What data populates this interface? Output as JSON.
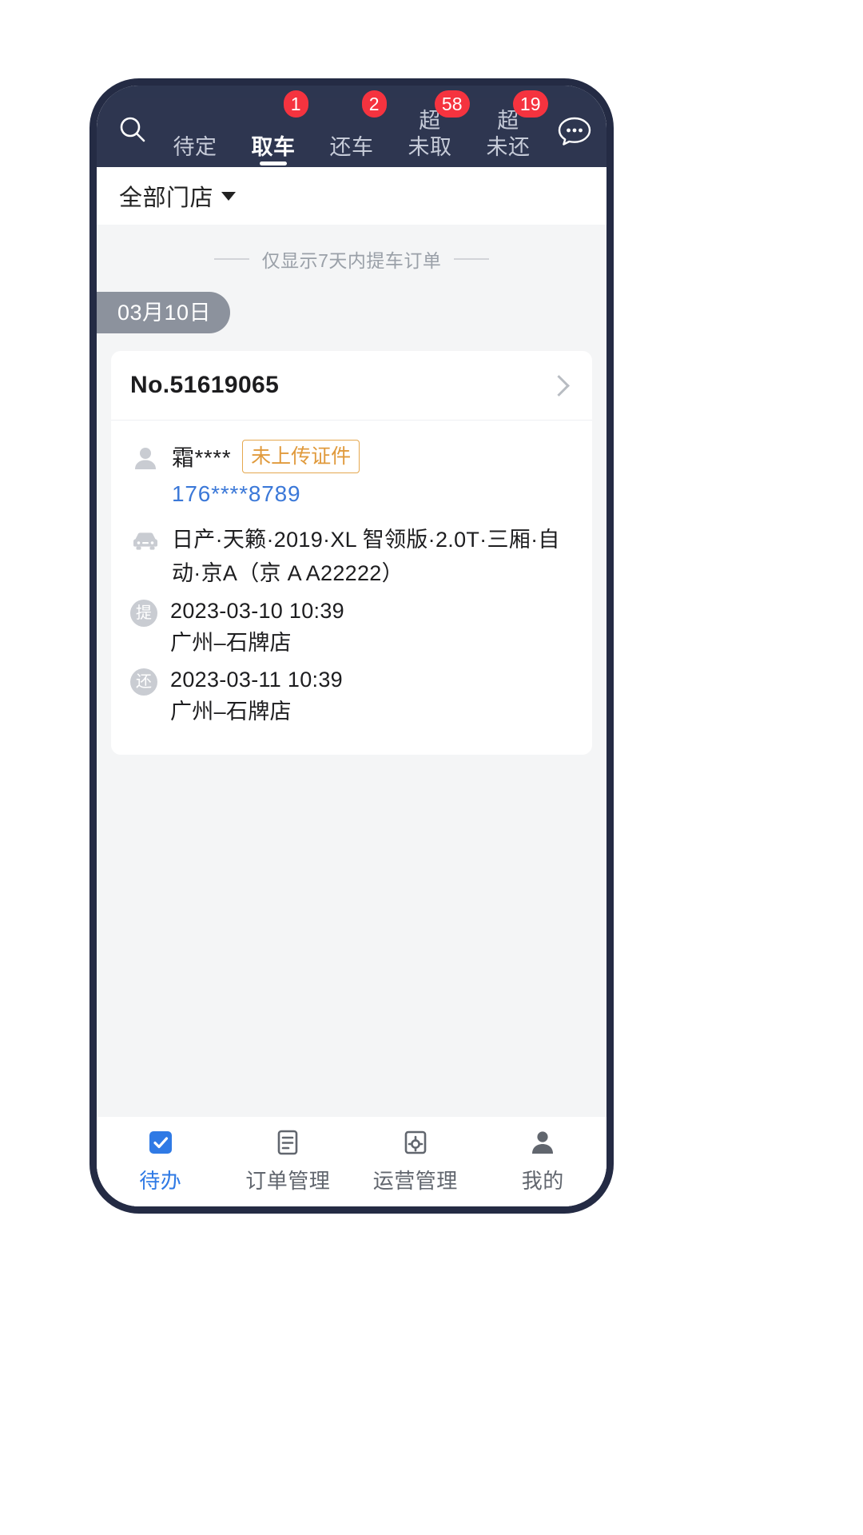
{
  "header": {
    "search_icon": "search-icon",
    "chat_icon": "chat-bubble-icon",
    "tabs": [
      {
        "label": "待定",
        "label2": "",
        "badge": "",
        "active": false
      },
      {
        "label": "取车",
        "label2": "",
        "badge": "1",
        "active": true
      },
      {
        "label": "还车",
        "label2": "",
        "badge": "2",
        "active": false
      },
      {
        "label": "超",
        "label2": "未取",
        "badge": "58",
        "active": false
      },
      {
        "label": "超",
        "label2": "未还",
        "badge": "19",
        "active": false
      }
    ]
  },
  "filter": {
    "label": "全部门店",
    "caret_icon": "chevron-down-icon"
  },
  "notice": {
    "text": "仅显示7天内提车订单"
  },
  "date_group": {
    "label": "03月10日"
  },
  "order": {
    "order_no": "No.51619065",
    "chevron_icon": "chevron-right-icon",
    "customer": {
      "icon": "person-icon",
      "name": "霜****",
      "cert_badge": "未上传证件",
      "phone": "176****8789"
    },
    "vehicle": {
      "icon": "car-icon",
      "text": "日产·天籁·2019·XL 智领版·2.0T·三厢·自动·京A（京 A A22222）"
    },
    "pickup": {
      "tag": "提",
      "datetime": "2023-03-10 10:39",
      "store": "广州–石牌店"
    },
    "return": {
      "tag": "还",
      "datetime": "2023-03-11 10:39",
      "store": "广州–石牌店"
    }
  },
  "bottom_nav": {
    "items": [
      {
        "label": "待办",
        "icon": "checkbox-task-icon",
        "active": true
      },
      {
        "label": "订单管理",
        "icon": "order-list-icon",
        "active": false
      },
      {
        "label": "运营管理",
        "icon": "operations-gear-icon",
        "active": false
      },
      {
        "label": "我的",
        "icon": "person-profile-icon",
        "active": false
      }
    ]
  },
  "colors": {
    "header_bg": "#2e3650",
    "badge_red": "#f5333f",
    "accent_blue": "#2f7ae5",
    "phone_blue": "#3b78d8",
    "cert_orange": "#e09a3c",
    "date_gray": "#8c929d",
    "content_bg": "#f4f5f6"
  }
}
